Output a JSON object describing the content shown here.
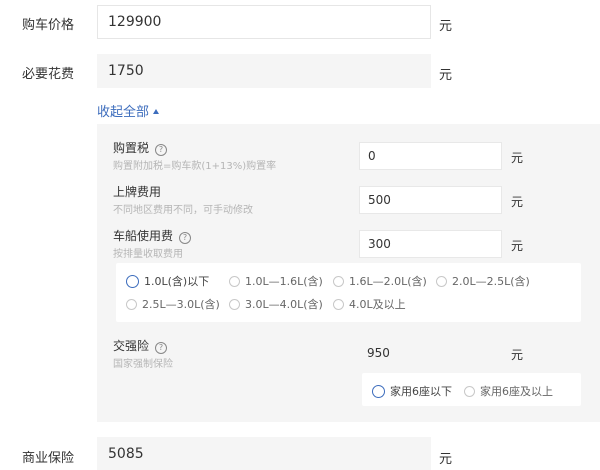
{
  "purchase_price": {
    "label": "购车价格",
    "value": "129900",
    "unit": "元"
  },
  "required_fees": {
    "label": "必要花费",
    "value": "1750",
    "unit": "元"
  },
  "collapse": {
    "label": "收起全部"
  },
  "purchase_tax": {
    "title": "购置税",
    "subtitle": "购置附加税=购车款(1+13%)购置率",
    "value": "0",
    "unit": "元"
  },
  "plate_fee": {
    "title": "上牌费用",
    "subtitle": "不同地区费用不同，可手动修改",
    "value": "500",
    "unit": "元"
  },
  "vessel_tax": {
    "title": "车船使用费",
    "subtitle": "按排量收取费用",
    "value": "300",
    "unit": "元",
    "options": [
      "1.0L(含)以下",
      "1.0L—1.6L(含)",
      "1.6L—2.0L(含)",
      "2.0L—2.5L(含)",
      "2.5L—3.0L(含)",
      "3.0L—4.0L(含)",
      "4.0L及以上"
    ],
    "selected": "1.0L(含)以下"
  },
  "compulsory_insurance": {
    "title": "交强险",
    "subtitle": "国家强制保险",
    "value": "950",
    "unit": "元",
    "options": [
      "家用6座以下",
      "家用6座及以上"
    ],
    "selected": "家用6座以下"
  },
  "commercial_insurance": {
    "label": "商业保险",
    "value": "5085",
    "unit": "元"
  },
  "help_glyph": "?",
  "colors": {
    "accent": "#3d6dbd",
    "panel_bg": "#f5f5f5",
    "muted_text": "#b5b5b5"
  }
}
